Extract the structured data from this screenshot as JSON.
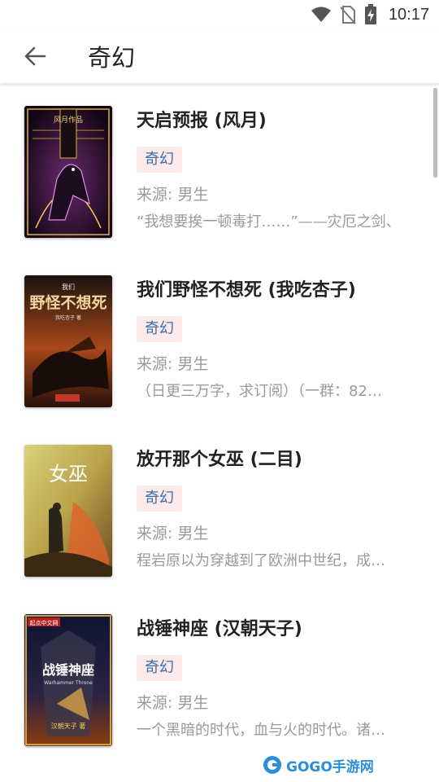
{
  "status": {
    "time": "10:17"
  },
  "header": {
    "title": "奇幻"
  },
  "books": [
    {
      "title": "天启预报 (风月)",
      "tag": "奇幻",
      "source": "来源: 男生",
      "desc": "“我想要挨一顿毒打……”——灾厄之剑、",
      "cover_text": "风月作品"
    },
    {
      "title": "我们野怪不想死 (我吃杏子)",
      "tag": "奇幻",
      "source": "来源: 男生",
      "desc": "（日更三万字，求订阅）（一群：82…",
      "cover_text": "野怪不想死",
      "cover_sub": "我们",
      "cover_author": "我吃杏子 著"
    },
    {
      "title": "放开那个女巫 (二目)",
      "tag": "奇幻",
      "source": "来源: 男生",
      "desc": "程岩原以为穿越到了欧洲中世纪，成…",
      "cover_text": "女巫"
    },
    {
      "title": "战锤神座 (汉朝天子)",
      "tag": "奇幻",
      "source": "来源: 男生",
      "desc": "一个黑暗的时代，血与火的时代。诸…",
      "cover_text": "战锤神座",
      "cover_sub": "Warhammer Throne",
      "cover_author": "汉朝天子 著",
      "cover_brand": "起点中文网"
    }
  ],
  "watermark": {
    "text": "GOGO手游网"
  },
  "colors": {
    "tag_bg": "#fdeaea",
    "tag_text": "#3b6ea8",
    "meta_text": "#9a9a9a"
  }
}
